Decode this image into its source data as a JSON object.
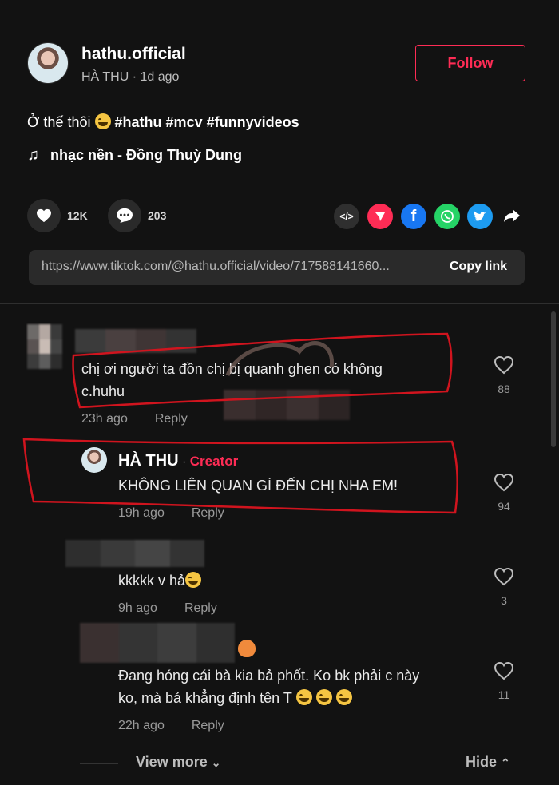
{
  "post": {
    "username": "hathu.official",
    "display_name": "HÀ THU",
    "time": "1d ago",
    "follow_label": "Follow",
    "caption_text": "Ở thế thôi",
    "hashtags": [
      "#hathu",
      "#mcv",
      "#funnyvideos"
    ],
    "music": "nhạc nền - Đồng Thuỳ Dung",
    "likes": "12K",
    "comments": "203",
    "link_url": "https://www.tiktok.com/@hathu.official/video/717588141660...",
    "copy_label": "Copy link",
    "share_icons": [
      "embed-icon",
      "send-icon",
      "facebook-icon",
      "whatsapp-icon",
      "twitter-icon",
      "share-arrow-icon"
    ]
  },
  "comments": [
    {
      "text_line1": "chị ơi người ta đồn chị bị quanh ghen có không",
      "text_line2": "c.huhu",
      "time": "23h ago",
      "reply_label": "Reply",
      "likes": "88"
    },
    {
      "author": "HÀ THU",
      "creator_tag": "Creator",
      "text": "KHÔNG LIÊN QUAN GÌ ĐẾN CHỊ NHA EM!",
      "time": "19h ago",
      "reply_label": "Reply",
      "likes": "94"
    },
    {
      "text": "kkkkk v hả",
      "time": "9h ago",
      "reply_label": "Reply",
      "likes": "3"
    },
    {
      "text_line1": "Đang hóng cái bà kia bả phốt. Ko bk phải c này",
      "text_line2": "ko, mà bả khẳng định tên T",
      "time": "22h ago",
      "reply_label": "Reply",
      "likes": "11"
    }
  ],
  "footer": {
    "view_more": "View more",
    "hide": "Hide"
  },
  "colors": {
    "accent": "#fe2c55",
    "background": "#121212",
    "annotation": "#d0141e"
  }
}
